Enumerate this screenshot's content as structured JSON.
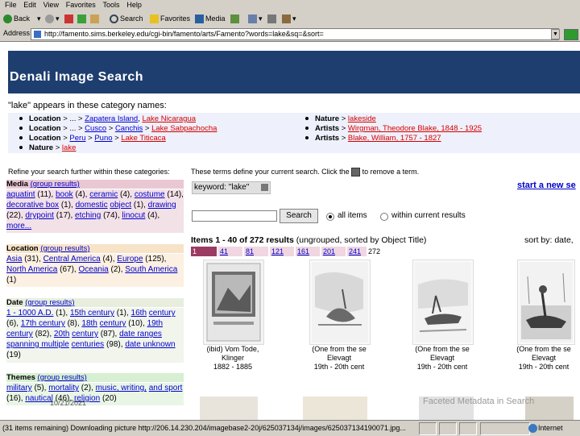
{
  "menubar": [
    "File",
    "Edit",
    "View",
    "Favorites",
    "Tools",
    "Help"
  ],
  "toolbar": {
    "back": "Back",
    "search": "Search",
    "favorites": "Favorites",
    "media": "Media"
  },
  "address": {
    "label": "Address",
    "url": "http://famento.sims.berkeley.edu/cgi-bin/famento/arts/Famento?words=lake&sq=&sort="
  },
  "page": {
    "title": "Denali Image Search",
    "lake_heading": "\"lake\" appears in these category names:",
    "categories_left": [
      {
        "prefix": "Location",
        "path": " > ... > ",
        "mid": "Zapatera Island",
        "sep": ", ",
        "link": "Lake Nicaragua"
      },
      {
        "prefix": "Location",
        "path": " > ... > ",
        "mid": "Cusco",
        "sep": " > ",
        "mid2": "Canchis",
        "sep2": " > ",
        "link": "Lake Sabpachocha"
      },
      {
        "prefix": "Location",
        "path": " > ",
        "mid": "Peru",
        "sep": " > ",
        "mid2": "Puno",
        "sep2": " > ",
        "link": "Lake Titicaca"
      },
      {
        "prefix": "Nature",
        "path": " > ",
        "link": "lake"
      }
    ],
    "categories_right": [
      {
        "prefix": "Nature",
        "path": " > ",
        "link": "lakeside"
      },
      {
        "prefix": "Artists",
        "path": " > ",
        "link": "Wirgman, Theodore Blake, 1848 - 1925"
      },
      {
        "prefix": "Artists",
        "path": " > ",
        "link": "Blake, William, 1757 - 1827"
      }
    ],
    "refine_text": "Refine your search further within these categories:",
    "terms_define": "These terms define your current search. Click the",
    "terms_define_end": "to remove a term.",
    "start_new": "start a new se",
    "keyword_chip": "keyword: \"lake\"",
    "search_button": "Search",
    "radio_all": "all items",
    "radio_within": "within current results",
    "items_count": "Items 1 - 40 of 272 results",
    "items_note": "(ungrouped, sorted by Object Title)",
    "sort_by": "sort by: date,",
    "pager": [
      "1",
      "41",
      "81",
      "121",
      "161",
      "201",
      "241",
      "272"
    ],
    "facets": {
      "media": {
        "title": "Media",
        "group": "(group results)",
        "body": [
          {
            "t": "aquatint",
            "c": " (11), "
          },
          {
            "t": "book",
            "c": " (4), "
          },
          {
            "t": "ceramic",
            "c": " (4),"
          },
          {
            "t": "costume",
            "c": " (14), "
          },
          {
            "t": "decorative box",
            "c": " (1), "
          },
          {
            "t": "domestic",
            "c": ""
          },
          {
            "t": "object",
            "c": " (1), "
          },
          {
            "t": "drawing",
            "c": " (22), "
          },
          {
            "t": "drypoint",
            "c": " (17),"
          },
          {
            "t": "etching",
            "c": " (74), "
          },
          {
            "t": "linocut",
            "c": " (4), "
          },
          {
            "t": "more...",
            "c": ""
          }
        ]
      },
      "location": {
        "title": "Location",
        "group": "(group results)",
        "body": [
          {
            "t": "Asia",
            "c": " (31), "
          },
          {
            "t": "Central America",
            "c": " (4),"
          },
          {
            "t": "Europe",
            "c": " (125), "
          },
          {
            "t": "North America",
            "c": " (67),"
          },
          {
            "t": "Oceania",
            "c": " (2), "
          },
          {
            "t": "South America",
            "c": " (1)"
          }
        ]
      },
      "date": {
        "title": "Date",
        "group": "(group results)",
        "body": [
          {
            "t": "1 - 1000 A.D.",
            "c": " (1), "
          },
          {
            "t": "15th century",
            "c": " (1), "
          },
          {
            "t": "16th",
            "c": ""
          },
          {
            "t": "century",
            "c": " (6), "
          },
          {
            "t": "17th century",
            "c": " (8), "
          },
          {
            "t": "18th",
            "c": ""
          },
          {
            "t": "century",
            "c": " (10), "
          },
          {
            "t": "19th century",
            "c": " (82), "
          },
          {
            "t": "20th",
            "c": ""
          },
          {
            "t": "century",
            "c": " (87), "
          },
          {
            "t": "date ranges spanning multiple",
            "c": ""
          },
          {
            "t": "centuries",
            "c": " (98), "
          },
          {
            "t": "date unknown",
            "c": " (19)"
          }
        ]
      },
      "themes": {
        "title": "Themes",
        "group": "(group results)",
        "body": [
          {
            "t": "military",
            "c": " (5), "
          },
          {
            "t": "mortality",
            "c": " (2), "
          },
          {
            "t": "music, writing,",
            "c": ""
          },
          {
            "t": "and sport",
            "c": " (16), "
          },
          {
            "t": "nautical",
            "c": " (46), "
          },
          {
            "t": "religion",
            "c": " (20)"
          }
        ]
      }
    },
    "thumbs": [
      {
        "cap1": "(ibid) Vom Tode,",
        "cap2": "Klinger",
        "cap3": "1882 - 1885"
      },
      {
        "cap1": "(One from the se",
        "cap2": "Elevagt",
        "cap3": "19th - 20th cent"
      },
      {
        "cap1": "(One from the se",
        "cap2": "Elevagt",
        "cap3": "19th - 20th cent"
      },
      {
        "cap1": "(One from the se",
        "cap2": "Elevagt",
        "cap3": "19th - 20th cent"
      }
    ],
    "watermark": "Faceted Metadata in Search",
    "overlay_note": "10/21/2021"
  },
  "status": {
    "text": "(31 items remaining) Downloading picture http://206.14.230.204/imagebase2-20j/625037134j/images/625037134190071.jpg...",
    "zone": "Internet"
  },
  "colors": {
    "banner": "#1e3e6f",
    "media": "#e9c8d3",
    "location": "#f7e3c8",
    "date": "#e7eedd",
    "themes": "#d7efd2",
    "catbox": "#eef0fb"
  }
}
